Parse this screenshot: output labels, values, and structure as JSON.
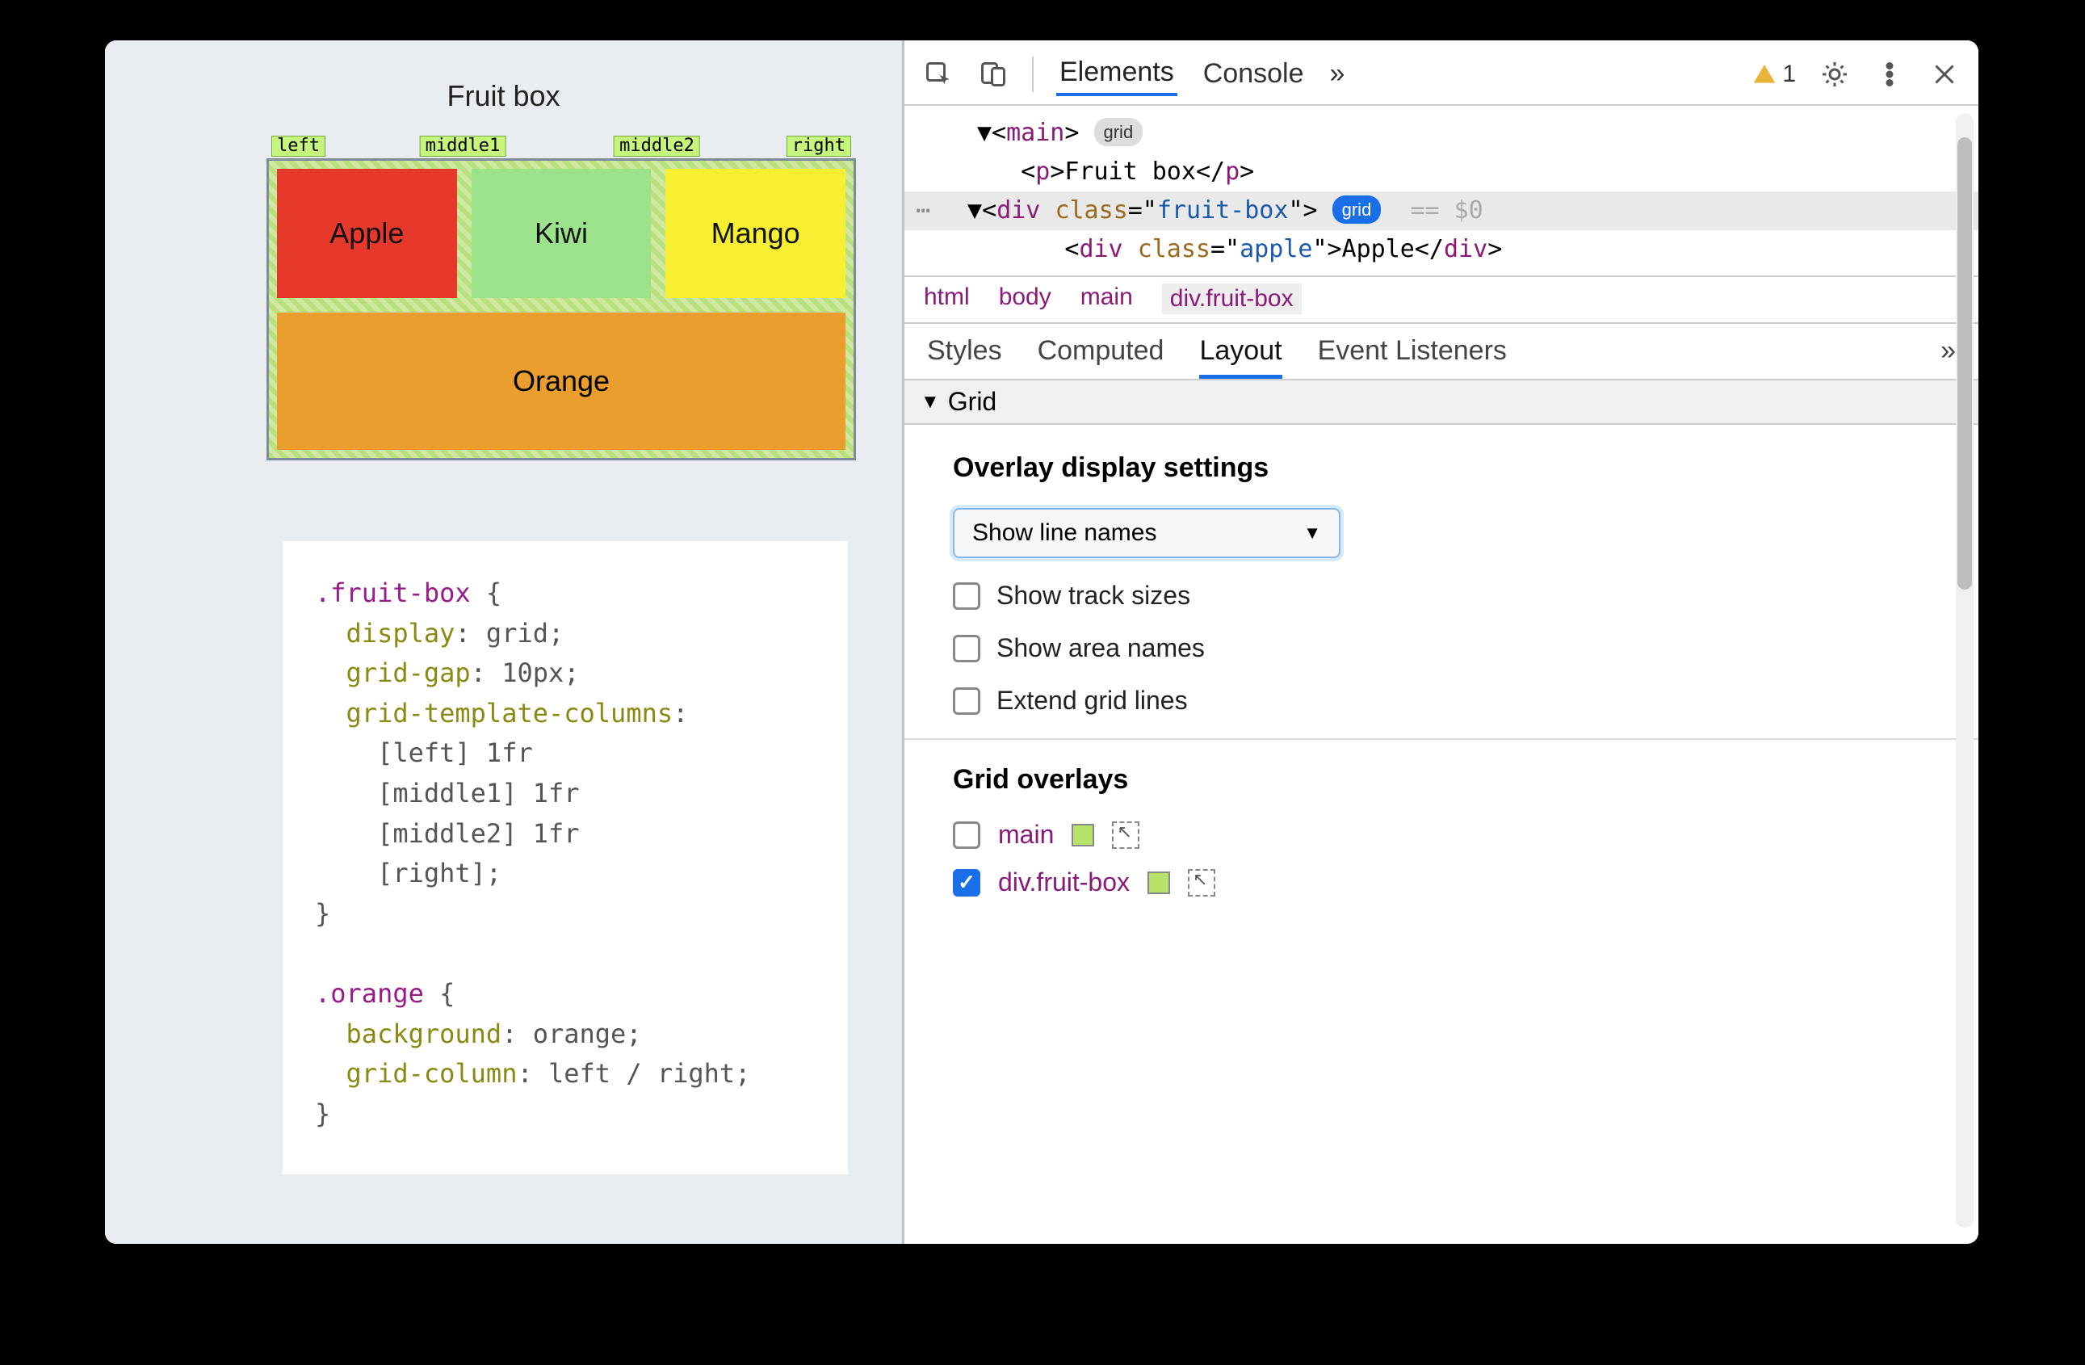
{
  "page": {
    "title": "Fruit box",
    "line_labels": {
      "left": "left",
      "mid1": "middle1",
      "mid2": "middle2",
      "right": "right"
    },
    "cells": {
      "apple": "Apple",
      "kiwi": "Kiwi",
      "mango": "Mango",
      "orange": "Orange"
    },
    "css": {
      "sel1": ".fruit-box",
      "rules1": [
        {
          "prop": "display",
          "val": "grid;"
        },
        {
          "prop": "grid-gap",
          "val": "10px;"
        },
        {
          "prop": "grid-template-columns",
          "val": ":"
        }
      ],
      "gtc_lines": [
        "    [left] 1fr",
        "    [middle1] 1fr",
        "    [middle2] 1fr",
        "    [right];"
      ],
      "sel2": ".orange",
      "rules2": [
        {
          "prop": "background",
          "val": "orange;"
        },
        {
          "prop": "grid-column",
          "val": "left / right;"
        }
      ]
    }
  },
  "devtools": {
    "tabs": {
      "elements": "Elements",
      "console": "Console"
    },
    "warning_count": "1",
    "dom": {
      "main_open": "main",
      "main_badge": "grid",
      "p_text": "Fruit box",
      "div_class_attr": "class",
      "div_class_val": "fruit-box",
      "div_badge": "grid",
      "div_suffix": "== $0",
      "apple_class": "apple",
      "apple_text": "Apple"
    },
    "breadcrumbs": [
      "html",
      "body",
      "main",
      "div.fruit-box"
    ],
    "styles_tabs": {
      "styles": "Styles",
      "computed": "Computed",
      "layout": "Layout",
      "listeners": "Event Listeners"
    },
    "section": "Grid",
    "overlay_settings": {
      "heading": "Overlay display settings",
      "dropdown": "Show line names",
      "options": [
        {
          "label": "Show track sizes",
          "checked": false
        },
        {
          "label": "Show area names",
          "checked": false
        },
        {
          "label": "Extend grid lines",
          "checked": false
        }
      ]
    },
    "grid_overlays": {
      "heading": "Grid overlays",
      "items": [
        {
          "name": "main",
          "checked": false
        },
        {
          "name": "div.fruit-box",
          "checked": true
        }
      ]
    }
  }
}
